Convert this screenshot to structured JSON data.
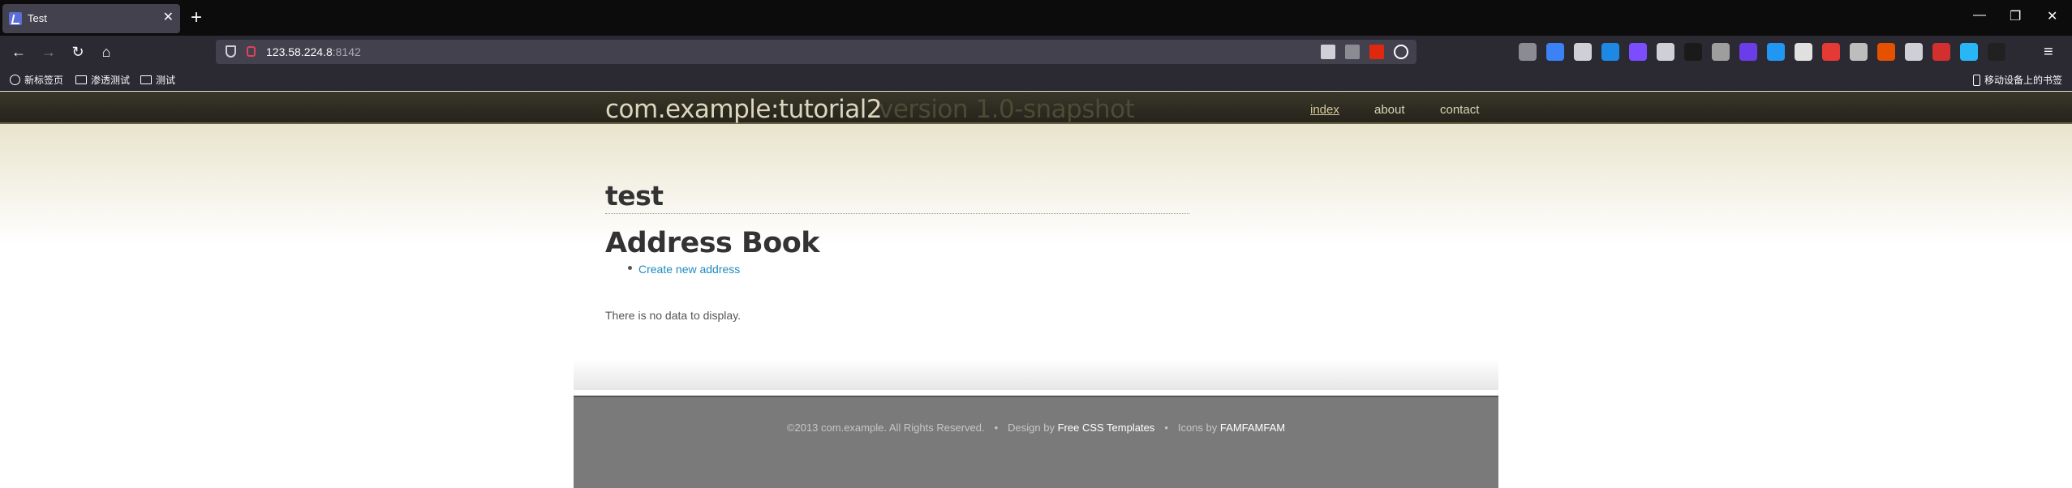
{
  "browser": {
    "tab_title": "Test",
    "new_tab": "+",
    "tab_close": "✕",
    "url_host": "123.58.224.8",
    "url_port": ":8142",
    "bookmarks": [
      "新标签页",
      "渗透测试",
      "测试"
    ],
    "mobile_bookmarks": "移动设备上的书签",
    "window_minimize": "—",
    "window_restore": "❐",
    "window_close": "✕",
    "extension_colors": [
      "#8b8b93",
      "#3b82f6",
      "#cfcfd8",
      "#1e88e5",
      "#7c4dff",
      "#cfcfd8",
      "#1a1a1a",
      "#9e9e9e",
      "#6a3de8",
      "#2196f3",
      "#e0e0e0",
      "#e53935",
      "#bdbdbd",
      "#e65100",
      "#cfcfd8",
      "#d32f2f",
      "#29b6f6",
      "#212121"
    ]
  },
  "site": {
    "logo": "com.example:tutorial2",
    "version": "version 1.0-snapshot",
    "menu": [
      "index",
      "about",
      "contact"
    ]
  },
  "main": {
    "page_title": "test",
    "section_title": "Address Book",
    "create_link": "Create new address",
    "empty_message": "There is no data to display."
  },
  "footer": {
    "copyright": "©2013 com.example. All Rights Reserved.",
    "separator": "•",
    "design_by": "Design by",
    "design_link": "Free CSS Templates",
    "icons_by": "Icons by",
    "icons_link": "FAMFAMFAM"
  },
  "colors": {
    "header_bg": "#2f2d23",
    "logo": "#dcd6bd",
    "link": "#1f8bbf",
    "footer_bg": "#7a7a7a"
  }
}
